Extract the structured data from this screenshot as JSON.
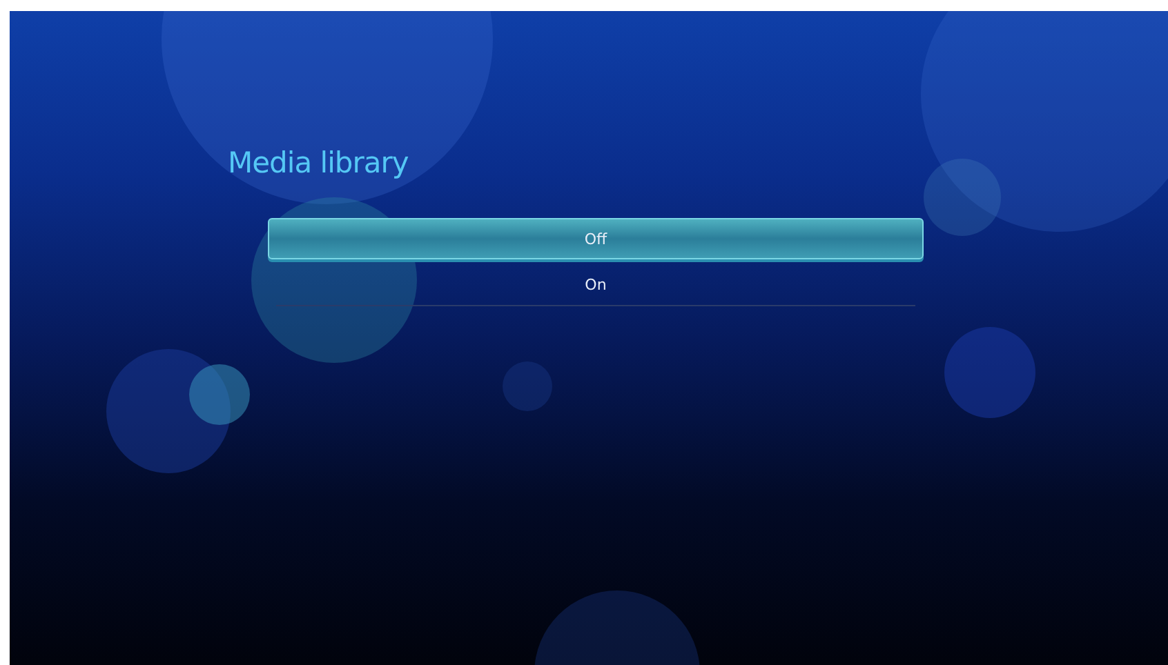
{
  "screen": {
    "title": "Media library"
  },
  "options": [
    {
      "label": "Off",
      "selected": true
    },
    {
      "label": "On",
      "selected": false
    }
  ]
}
